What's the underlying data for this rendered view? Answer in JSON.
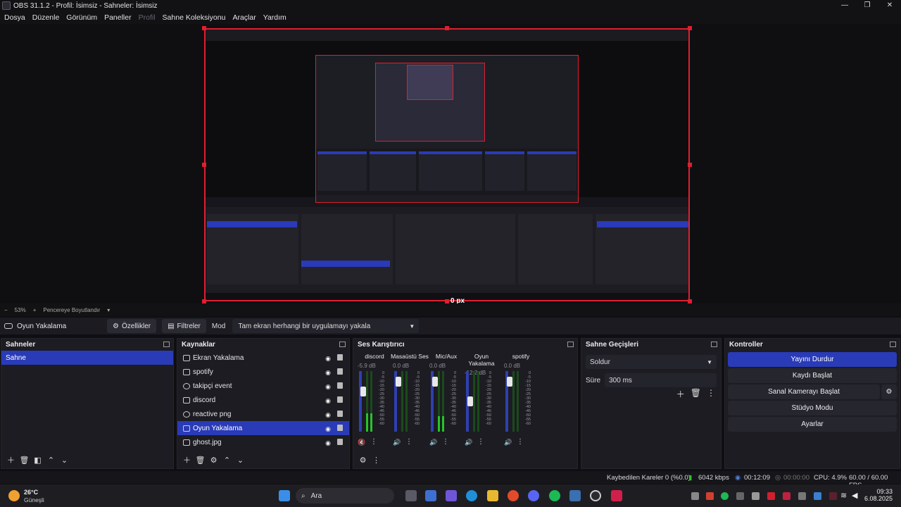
{
  "window": {
    "title": "OBS 31.1.2 - Profil: İsimsiz - Sahneler: İsimsiz",
    "controls": [
      "—",
      "❐",
      "✕"
    ]
  },
  "menu": [
    "Dosya",
    "Düzenle",
    "Görünüm",
    "Paneller",
    "Profil",
    "Sahne Koleksiyonu",
    "Araçlar",
    "Yardım"
  ],
  "preview": {
    "offset_label": "0 px",
    "zoom": "53%",
    "fit_label": "Pencereye Boyutlandır",
    "zoom_minus": "−",
    "zoom_plus": "+"
  },
  "source_toolbar": {
    "source_name": "Oyun Yakalama",
    "properties_label": "Özellikler",
    "filters_label": "Filtreler",
    "mode_label": "Mod",
    "mode_value": "Tam ekran herhangi bir uygulamayı yakala"
  },
  "scenes": {
    "title": "Sahneler",
    "items": [
      "Sahne"
    ]
  },
  "sources": {
    "title": "Kaynaklar",
    "items": [
      "Ekran Yakalama",
      "spotify",
      "takipçi event",
      "discord",
      "reactive png",
      "Oyun Yakalama",
      "ghost.jpg"
    ]
  },
  "mixer": {
    "title": "Ses Karıştırıcı",
    "channels": [
      {
        "name": "discord",
        "db": "-5.9 dB",
        "level": 0.3,
        "muted": true
      },
      {
        "name": "Masaüstü Ses",
        "db": "0.0 dB",
        "level": 0.0,
        "muted": false
      },
      {
        "name": "Mic/Aux",
        "db": "0.0 dB",
        "level": 0.25,
        "muted": false
      },
      {
        "name": "Oyun Yakalama",
        "db": "-12.2 dB",
        "level": 0.0,
        "muted": false
      },
      {
        "name": "spotify",
        "db": "0.0 dB",
        "level": 0.0,
        "muted": false
      }
    ],
    "scale": [
      "0",
      "-5",
      "-10",
      "-15",
      "-20",
      "-25",
      "-30",
      "-35",
      "-40",
      "-45",
      "-50",
      "-55",
      "-60"
    ]
  },
  "transitions": {
    "title": "Sahne Geçişleri",
    "transition": "Soldur",
    "duration_label": "Süre",
    "duration": "300 ms"
  },
  "controls": {
    "title": "Kontroller",
    "stop_stream": "Yayını Durdur",
    "start_record": "Kaydı Başlat",
    "start_vcam": "Sanal Kamerayı Başlat",
    "studio_mode": "Stüdyo Modu",
    "settings": "Ayarlar"
  },
  "status": {
    "dropped": "Kaybedilen Kareler 0 (%0.0)",
    "bitrate": "6042 kbps",
    "stream_time": "00:12:09",
    "rec_time": "00:00:00",
    "cpu": "CPU: 4.9%",
    "fps": "60.00 / 60.00 FPS"
  },
  "taskbar": {
    "weather_temp": "26°C",
    "weather_desc": "Güneşli",
    "search_label": "Ara",
    "time": "09:33",
    "date": "6.08.2025"
  },
  "colors": {
    "accent": "#2a3bb7",
    "selection_border": "#e01f2f",
    "meter_green": "#27c427"
  }
}
